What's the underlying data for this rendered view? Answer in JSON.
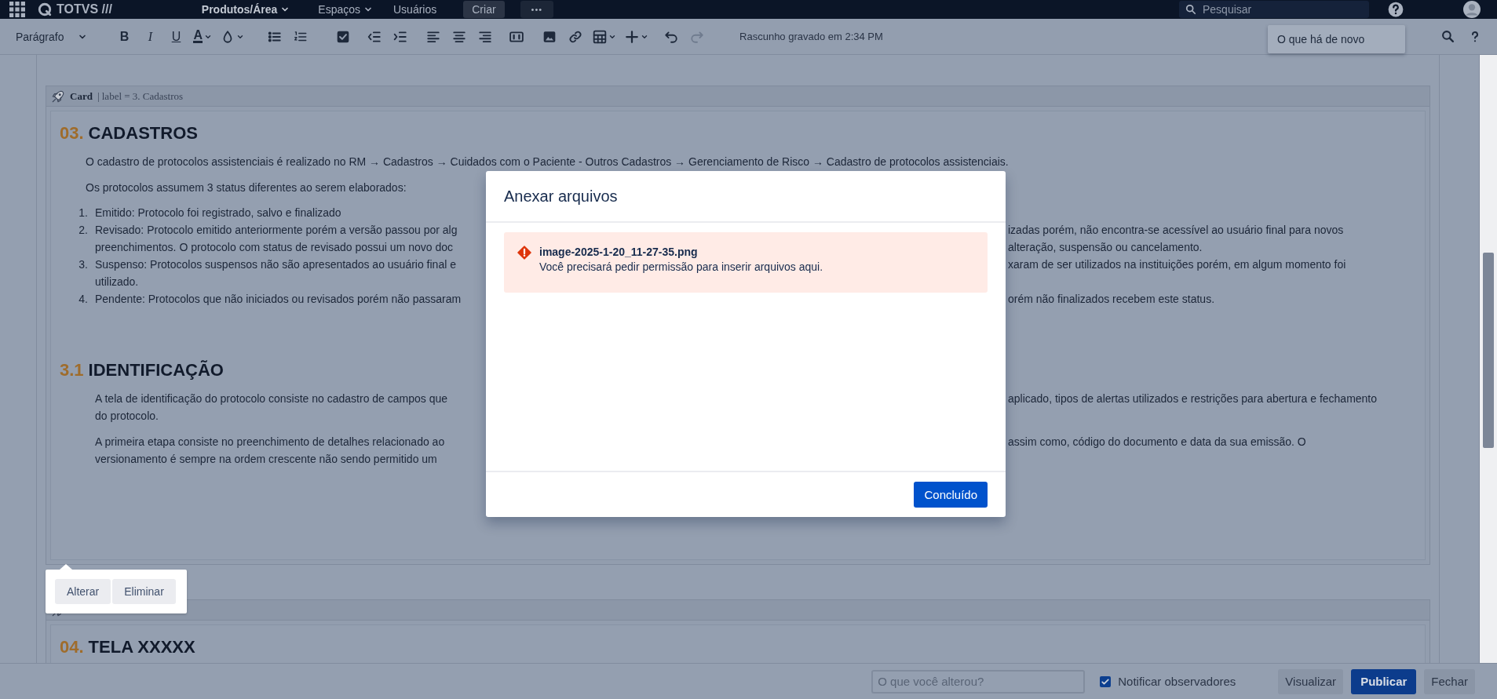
{
  "header": {
    "logo": "TOTVS ///",
    "nav": [
      {
        "label": "Produtos/Área",
        "kind": "app-menu"
      },
      {
        "label": "Espaços",
        "kind": "dropdown"
      },
      {
        "label": "Usuários",
        "kind": "link"
      },
      {
        "label": "Criar",
        "kind": "button"
      },
      {
        "label": "•••",
        "kind": "more"
      }
    ],
    "search": {
      "placeholder": "Pesquisar"
    }
  },
  "toolbar": {
    "style_select": "Parágrafo",
    "tools": [
      {
        "kind": "bold",
        "label": "B",
        "disabled": false
      },
      {
        "kind": "italic",
        "label": "I",
        "disabled": false
      },
      {
        "kind": "underline",
        "label": "U",
        "disabled": false
      },
      {
        "kind": "text-color",
        "label": "A",
        "disabled": false
      },
      {
        "kind": "text-style",
        "disabled": false
      },
      {
        "kind": "bullet-list",
        "disabled": false
      },
      {
        "kind": "numbered-list",
        "disabled": false
      },
      {
        "kind": "task",
        "disabled": false
      },
      {
        "kind": "outdent",
        "disabled": false
      },
      {
        "kind": "indent",
        "disabled": false
      },
      {
        "kind": "align-left",
        "disabled": false
      },
      {
        "kind": "align-center",
        "disabled": false
      },
      {
        "kind": "align-right",
        "disabled": false
      },
      {
        "kind": "layout",
        "disabled": false
      },
      {
        "kind": "image",
        "disabled": false
      },
      {
        "kind": "link",
        "disabled": false
      },
      {
        "kind": "table",
        "disabled": false
      },
      {
        "kind": "insert",
        "disabled": false
      },
      {
        "kind": "undo",
        "disabled": false
      },
      {
        "kind": "redo",
        "disabled": true
      }
    ],
    "status": "Rascunho gravado em 2:34 PM",
    "whats_new": "O que há de novo"
  },
  "document": {
    "cards": [
      {
        "macro_name": "Card",
        "macro_params": "| label = 3. Cadastros",
        "blocks": [
          {
            "kind": "heading",
            "number": "03.",
            "title": "CADASTROS"
          },
          {
            "kind": "paragraph",
            "lines": [
              {
                "text": "O cadastro de protocolos assistenciais é realizado no RM → Cadastros → Cuidados com o Paciente - Outros Cadastros → Gerenciamento de Risco → Cadastro de protocolos assistenciais."
              }
            ]
          },
          {
            "kind": "paragraph",
            "lines": [
              {
                "text": "Os protocolos assumem 3 status diferentes ao serem elaborados:"
              }
            ]
          },
          {
            "kind": "list",
            "items": [
              {
                "number": "1.",
                "lines": [
                  {
                    "text": "Emitido: Protocolo foi registrado, salvo e finalizado"
                  }
                ]
              },
              {
                "number": "2.",
                "lines": [
                  {
                    "text": "Revisado: Protocolo emitido anteriormente porém a versão passou por alg",
                    "text_after": "izadas porém, não encontra-se acessível ao usuário final para novos"
                  },
                  {
                    "text": "preenchimentos. O protocolo com status de revisado possui um novo doc",
                    "text_after": "alteração, suspensão ou cancelamento."
                  }
                ]
              },
              {
                "number": "3.",
                "lines": [
                  {
                    "text": "Suspenso: Protocolos suspensos não são apresentados ao usuário final e",
                    "text_after": "xaram de ser utilizados na instituições porém, em algum momento foi"
                  },
                  {
                    "text": "utilizado."
                  }
                ]
              },
              {
                "number": "4.",
                "lines": [
                  {
                    "text": "Pendente: Protocolos que não iniciados ou revisados porém não passaram",
                    "text_after": "orém não finalizados recebem este status."
                  }
                ]
              }
            ]
          },
          {
            "kind": "heading",
            "number": "3.1",
            "title": "IDENTIFICAÇÃO"
          },
          {
            "kind": "subparagraph",
            "lines": [
              {
                "text": "A tela de identificação do protocolo consiste no cadastro de campos que",
                "text_after": "aplicado, tipos de alertas utilizados e restrições para abertura e fechamento"
              },
              {
                "text": "do protocolo."
              }
            ]
          },
          {
            "kind": "subparagraph",
            "lines": [
              {
                "text": "A primeira etapa consiste no preenchimento de detalhes relacionado ao",
                "text_after": "assim como, código do documento e data da sua emissão. O"
              },
              {
                "text": "versionamento é sempre na ordem crescente não sendo permitido um"
              }
            ]
          }
        ]
      },
      {
        "blocks": [
          {
            "kind": "heading",
            "number": "04.",
            "title": "TELA XXXXX"
          }
        ]
      }
    ]
  },
  "macro_popup": {
    "buttons": [
      "Alterar",
      "Eliminar"
    ]
  },
  "footer": {
    "comment": {
      "placeholder": "O que você alterou?"
    },
    "notify": {
      "label": "Notificar observadores",
      "checked": true
    },
    "buttons": [
      {
        "label": "Visualizar",
        "kind": "secondary"
      },
      {
        "label": "Publicar",
        "kind": "primary"
      },
      {
        "label": "Fechar",
        "kind": "secondary"
      }
    ]
  },
  "dialog": {
    "title": "Anexar arquivos",
    "error": {
      "file": "image-2025-1-20_11-27-35.png",
      "message": "Você precisará pedir permissão para inserir arquivos aqui."
    },
    "button": "Concluído"
  }
}
